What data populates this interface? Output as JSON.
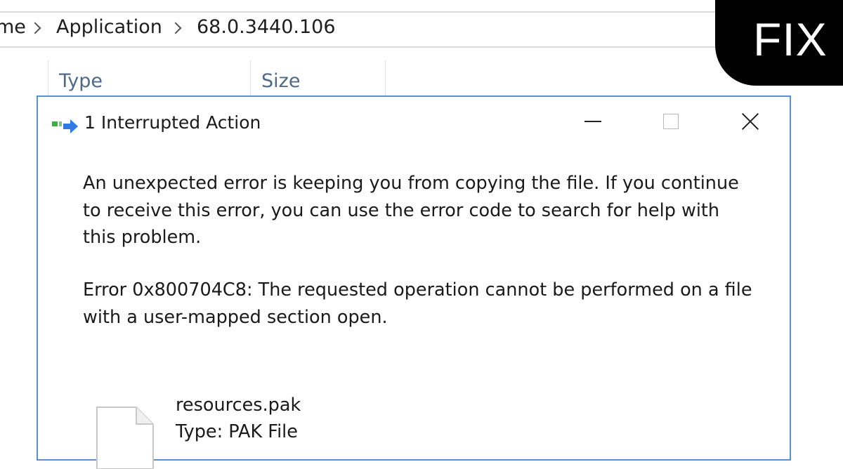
{
  "breadcrumb": {
    "items": [
      "me",
      "Application",
      "68.0.3440.106"
    ]
  },
  "file_list": {
    "columns": [
      "Type",
      "Size"
    ]
  },
  "badge": {
    "label": "FIX"
  },
  "dialog": {
    "title": "1 Interrupted Action",
    "icon": "copy-arrow-icon",
    "message": "An unexpected error is keeping you from copying the file. If you continue to receive this error, you can use the error code to search for help with this problem.",
    "error": "Error 0x800704C8: The requested operation cannot be performed on a file with a user-mapped section open.",
    "file": {
      "name": "resources.pak",
      "type": "Type: PAK File"
    }
  },
  "colors": {
    "dialog_border": "#5a8fd0",
    "column_header": "#4d6a87",
    "badge_bg": "#000000",
    "badge_text": "#ffffff"
  }
}
